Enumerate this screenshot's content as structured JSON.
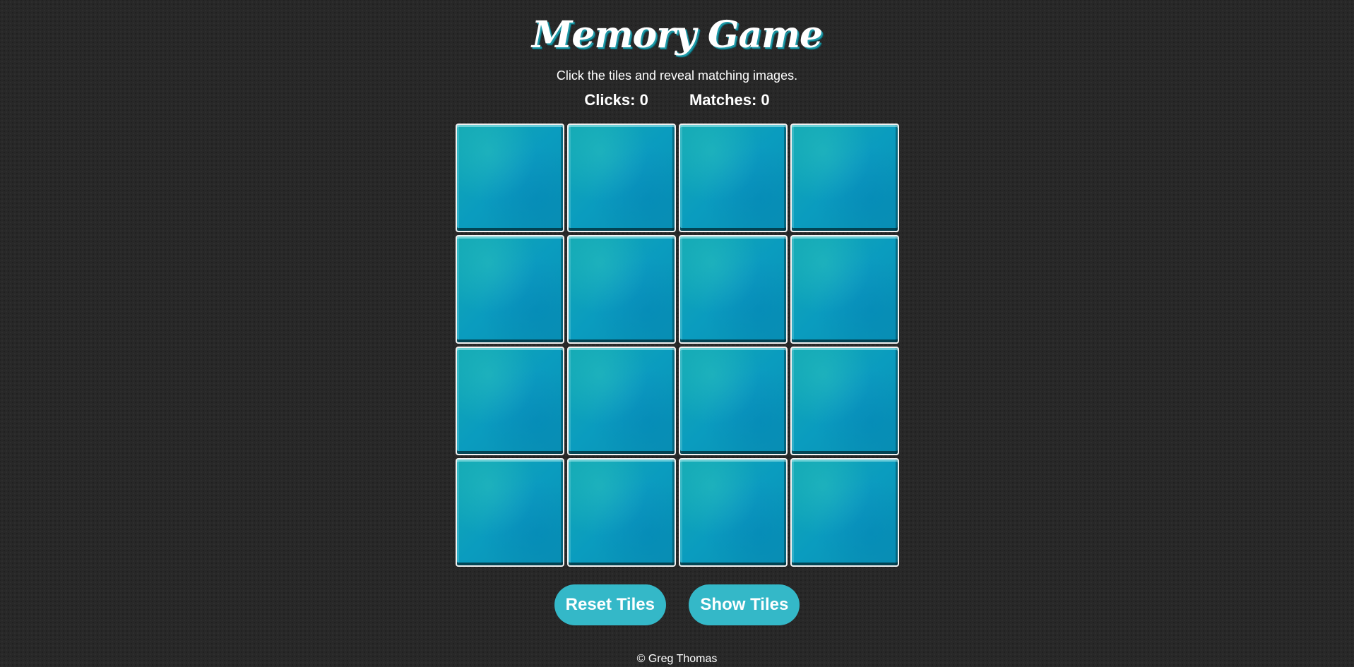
{
  "header": {
    "title": "Memory Game",
    "subtitle": "Click the tiles and reveal matching images."
  },
  "stats": {
    "clicks": "Clicks: 0",
    "matches": "Matches: 0"
  },
  "board": {
    "rows": 4,
    "columns": 4,
    "tile_state": "face-down",
    "tile_color": "#0a9cbf"
  },
  "buttons": {
    "reset_label": "Reset Tiles",
    "show_label": "Show Tiles",
    "button_color": "#34b8c8"
  },
  "footer": {
    "copyright": "© Greg Thomas"
  },
  "colors": {
    "background": "#282828",
    "text": "#ffffff",
    "accent": "#1e9aa8"
  }
}
